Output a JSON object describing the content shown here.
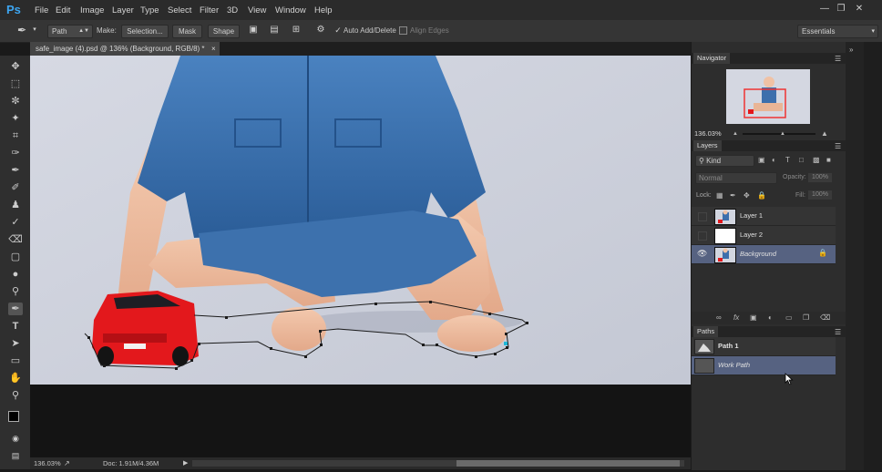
{
  "app": {
    "logo": "Ps"
  },
  "menu": [
    "File",
    "Edit",
    "Image",
    "Layer",
    "Type",
    "Select",
    "Filter",
    "3D",
    "View",
    "Window",
    "Help"
  ],
  "options": {
    "tool_mode": "Path",
    "make_label": "Make:",
    "selection_btn": "Selection...",
    "mask_btn": "Mask",
    "shape_btn": "Shape",
    "auto_add_delete": "Auto Add/Delete",
    "align_edges": "Align Edges",
    "workspace": "Essentials"
  },
  "document_tab": {
    "title": "safe_image (4).psd @ 136% (Background, RGB/8) *"
  },
  "status": {
    "zoom": "136.03%",
    "doc": "Doc: 1.91M/4.36M"
  },
  "navigator": {
    "tab": "Navigator",
    "zoom": "136.03%"
  },
  "layers": {
    "tab": "Layers",
    "kind": "Kind",
    "blend": "Normal",
    "opacity_label": "Opacity:",
    "opacity_value": "100%",
    "lock_label": "Lock:",
    "fill_label": "Fill:",
    "fill_value": "100%",
    "items": [
      {
        "name": "Layer 1"
      },
      {
        "name": "Layer 2"
      },
      {
        "name": "Background"
      }
    ]
  },
  "paths": {
    "tab": "Paths",
    "items": [
      {
        "name": "Path 1"
      },
      {
        "name": "Work Path"
      }
    ]
  },
  "colors": {
    "accent": "#3da6f2",
    "selected_row": "#566281",
    "path_stroke": "#1b1b1b"
  }
}
